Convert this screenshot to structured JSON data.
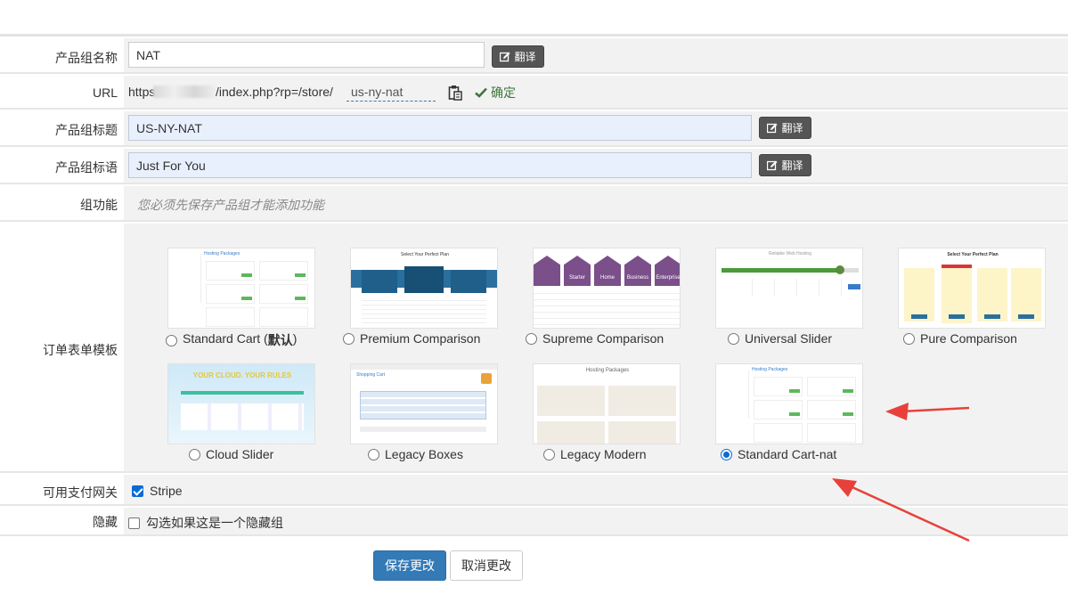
{
  "fields": {
    "group_name": {
      "label": "产品组名称",
      "value": "NAT"
    },
    "url": {
      "label": "URL",
      "prefix": "https:",
      "suffix": "/index.php?rp=/store/",
      "slug": "us-ny-nat",
      "confirm": "确定"
    },
    "group_title": {
      "label": "产品组标题",
      "value": "US-NY-NAT"
    },
    "group_tagline": {
      "label": "产品组标语",
      "value": "Just For You"
    },
    "group_features": {
      "label": "组功能",
      "hint": "您必须先保存产品组才能添加功能"
    },
    "order_template": {
      "label": "订单表单模板"
    },
    "payment_gateways": {
      "label": "可用支付网关",
      "option": "Stripe"
    },
    "hidden": {
      "label": "隐藏",
      "option": "勾选如果这是一个隐藏组"
    }
  },
  "translate_label": "翻译",
  "templates": [
    {
      "name": "Standard Cart (",
      "bold": "默认",
      "tail": ")",
      "selected": false,
      "style": "cart"
    },
    {
      "name": "Premium Comparison",
      "selected": false,
      "style": "premium"
    },
    {
      "name": "Supreme Comparison",
      "selected": false,
      "style": "supreme"
    },
    {
      "name": "Universal Slider",
      "selected": false,
      "style": "slider"
    },
    {
      "name": "Pure Comparison",
      "selected": false,
      "style": "pure"
    },
    {
      "name": "Cloud Slider",
      "selected": false,
      "style": "cloud"
    },
    {
      "name": "Legacy Boxes",
      "selected": false,
      "style": "boxes"
    },
    {
      "name": "Legacy Modern",
      "selected": false,
      "style": "modern"
    },
    {
      "name": "Standard Cart-nat",
      "selected": true,
      "style": "cart"
    }
  ],
  "thumbnail_text": {
    "cart": "Hosting Packages",
    "premium": "Select Your Perfect Plan",
    "supreme_tiers": [
      "Starter",
      "Home",
      "Business",
      "Enterprise"
    ],
    "slider": "Reliable Web Hosting",
    "pure": "Select Your Perfect Plan",
    "cloud": "YOUR CLOUD. YOUR RULES",
    "boxes": "Shopping Cart",
    "modern": "Hosting Packages"
  },
  "buttons": {
    "save": "保存更改",
    "cancel": "取消更改"
  },
  "colors": {
    "primary": "#337ab7",
    "confirm": "#3c763d",
    "arrow": "#e8413a",
    "radio": "#0b6bd6"
  }
}
